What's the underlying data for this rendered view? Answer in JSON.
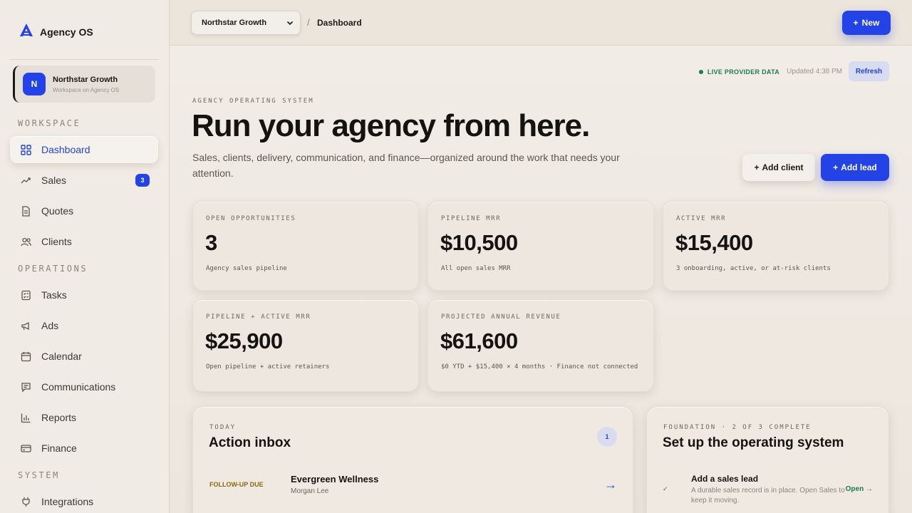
{
  "app": {
    "name": "Agency OS"
  },
  "workspace": {
    "name": "Northstar Growth",
    "initial": "N",
    "subtitle": "Workspace on Agency OS"
  },
  "sidebar": {
    "sections": {
      "workspace": "WORKSPACE",
      "operations": "OPERATIONS",
      "system": "SYSTEM"
    },
    "items": [
      {
        "label": "Dashboard",
        "icon": "grid-icon",
        "active": true
      },
      {
        "label": "Sales",
        "icon": "trending-up-icon",
        "badge": "3"
      },
      {
        "label": "Quotes",
        "icon": "document-icon"
      },
      {
        "label": "Clients",
        "icon": "users-icon"
      },
      {
        "label": "Tasks",
        "icon": "checklist-icon"
      },
      {
        "label": "Ads",
        "icon": "megaphone-icon"
      },
      {
        "label": "Calendar",
        "icon": "calendar-icon"
      },
      {
        "label": "Communications",
        "icon": "chat-icon"
      },
      {
        "label": "Reports",
        "icon": "bar-chart-icon"
      },
      {
        "label": "Finance",
        "icon": "credit-card-icon"
      },
      {
        "label": "Integrations",
        "icon": "plug-icon"
      }
    ]
  },
  "topbar": {
    "workspace_select": "Northstar Growth",
    "separator": "/",
    "breadcrumb": "Dashboard",
    "new_label": "New"
  },
  "status": {
    "live_label": "LIVE PROVIDER DATA",
    "updated": "Updated 4:38 PM",
    "refresh_label": "Refresh"
  },
  "hero": {
    "eyebrow": "AGENCY OPERATING SYSTEM",
    "title": "Run your agency from here.",
    "subtitle": "Sales, clients, delivery, communication, and finance—organized around the work that needs your attention.",
    "add_client_label": "Add client",
    "add_lead_label": "Add lead"
  },
  "kpis": [
    {
      "label": "OPEN OPPORTUNITIES",
      "value": "3",
      "caption": "Agency sales pipeline"
    },
    {
      "label": "PIPELINE MRR",
      "value": "$10,500",
      "caption": "All open sales MRR"
    },
    {
      "label": "ACTIVE MRR",
      "value": "$15,400",
      "caption": "3 onboarding, active, or at-risk clients"
    },
    {
      "label": "PIPELINE + ACTIVE MRR",
      "value": "$25,900",
      "caption": "Open pipeline + active retainers"
    },
    {
      "label": "PROJECTED ANNUAL REVENUE",
      "value": "$61,600",
      "caption": "$0 YTD + $15,400 × 4 months · Finance not connected"
    }
  ],
  "inbox": {
    "eyebrow": "TODAY",
    "title": "Action inbox",
    "count": "1",
    "items": [
      {
        "tag": "FOLLOW-UP DUE",
        "name": "Evergreen Wellness",
        "person": "Morgan Lee",
        "arrow": "→"
      }
    ]
  },
  "setup": {
    "eyebrow": "FOUNDATION · 2 OF 3 COMPLETE",
    "title": "Set up the operating system",
    "items": [
      {
        "check": "✓",
        "title": "Add a sales lead",
        "desc": "A durable sales record is in place. Open Sales to keep it moving.",
        "action": "Open →"
      }
    ]
  },
  "colors": {
    "accent": "#2343e6",
    "success": "#1f7a4d",
    "warning": "#8a6a12",
    "background": "#efe9e1"
  }
}
